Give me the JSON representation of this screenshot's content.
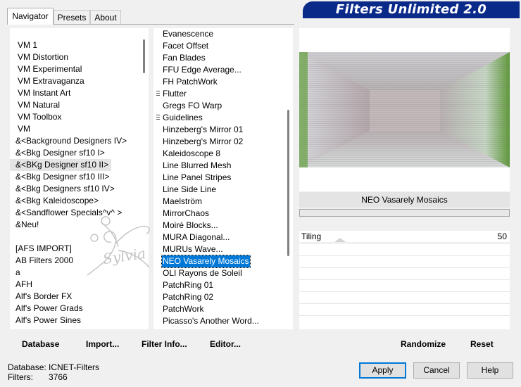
{
  "app": {
    "title": "Filters Unlimited 2.0"
  },
  "tabs": [
    {
      "label": "Navigator"
    },
    {
      "label": "Presets"
    },
    {
      "label": "About"
    }
  ],
  "categories": [
    {
      "label": "VM 1"
    },
    {
      "label": "VM Distortion"
    },
    {
      "label": "VM Experimental"
    },
    {
      "label": "VM Extravaganza"
    },
    {
      "label": "VM Instant Art"
    },
    {
      "label": "VM Natural"
    },
    {
      "label": "VM Toolbox"
    },
    {
      "label": "VM"
    },
    {
      "label": "&<Background Designers IV>"
    },
    {
      "label": "&<Bkg Designer sf10 I>"
    },
    {
      "label": "&<BKg Designer sf10 II>"
    },
    {
      "label": "&<Bkg Designer sf10 III>"
    },
    {
      "label": "&<Bkg Designers sf10 IV>"
    },
    {
      "label": "&<Bkg Kaleidoscope>"
    },
    {
      "label": "&<Sandflower Specials^v^ >"
    },
    {
      "label": "&Neu!"
    },
    {
      "label": ""
    },
    {
      "label": "[AFS IMPORT]"
    },
    {
      "label": "AB Filters 2000"
    },
    {
      "label": "a"
    },
    {
      "label": "AFH"
    },
    {
      "label": "Alf's Border FX"
    },
    {
      "label": "Alf's Power Grads"
    },
    {
      "label": "Alf's Power Sines"
    }
  ],
  "filters": [
    {
      "label": "Evanescence"
    },
    {
      "label": "Facet Offset"
    },
    {
      "label": "Fan Blades"
    },
    {
      "label": "FFU Edge Average..."
    },
    {
      "label": "FH PatchWork"
    },
    {
      "label": "Flutter"
    },
    {
      "label": "Gregs FO Warp"
    },
    {
      "label": "Guidelines"
    },
    {
      "label": "Hinzeberg's Mirror 01"
    },
    {
      "label": "Hinzeberg's Mirror 02"
    },
    {
      "label": "Kaleidoscope 8"
    },
    {
      "label": "Line Blurred Mesh"
    },
    {
      "label": "Line Panel Stripes"
    },
    {
      "label": "Line Side Line"
    },
    {
      "label": "Maelström"
    },
    {
      "label": "MirrorChaos"
    },
    {
      "label": "Moiré Blocks..."
    },
    {
      "label": "MURA Diagonal..."
    },
    {
      "label": "MURUs Wave..."
    },
    {
      "label": "NEO Vasarely Mosaics"
    },
    {
      "label": "OLI Rayons de Soleil"
    },
    {
      "label": "PatchRing 01"
    },
    {
      "label": "PatchRing 02"
    },
    {
      "label": "PatchWork"
    },
    {
      "label": "Picasso's Another Word..."
    }
  ],
  "watermark": {
    "text": "Sylvia"
  },
  "preview": {
    "filter_name": "NEO Vasarely Mosaics"
  },
  "params": [
    {
      "label": "Tiling",
      "value": "50"
    }
  ],
  "buttons": {
    "database": "Database",
    "import": "Import...",
    "filter_info": "Filter Info...",
    "editor": "Editor...",
    "randomize": "Randomize",
    "reset": "Reset",
    "apply": "Apply",
    "cancel": "Cancel",
    "help": "Help"
  },
  "status": {
    "database_label": "Database:",
    "database_value": "ICNET-Filters",
    "filters_label": "Filters:",
    "filters_value": "3766"
  }
}
